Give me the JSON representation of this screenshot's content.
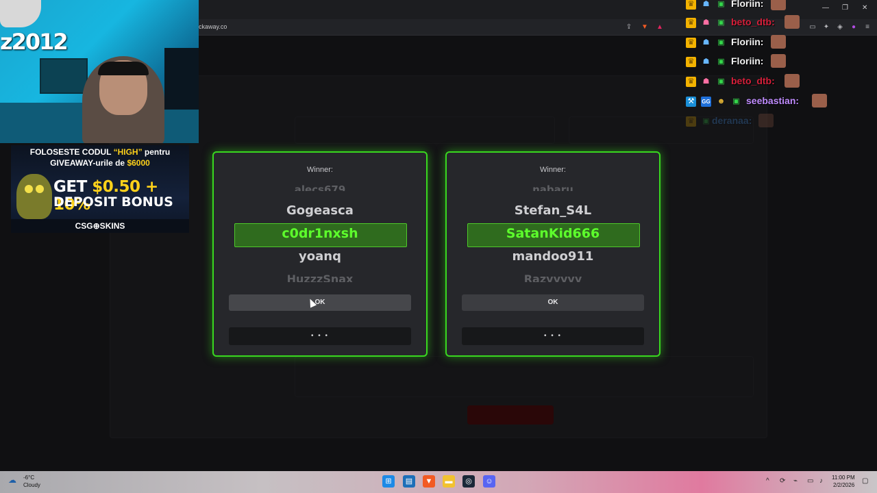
{
  "browser": {
    "url": "ckaway.co",
    "toolbar_icons": [
      "share-icon",
      "brave-shield-icon",
      "rewards-icon"
    ],
    "window_controls": [
      "minimize-icon",
      "maximize-icon",
      "close-icon"
    ]
  },
  "modals": [
    {
      "title": "Winner:",
      "names": [
        "alecs679",
        "Gogeasca",
        "c0dr1nxsh",
        "yoanq",
        "HuzzzSnax"
      ],
      "winner": "c0dr1nxsh",
      "ok_label": "OK",
      "dots_label": "• • •"
    },
    {
      "title": "Winner:",
      "names": [
        "nabaru",
        "Stefan_S4L",
        "SatanKid666",
        "mandoo911",
        "Razyyyyy"
      ],
      "winner": "SatanKid666",
      "ok_label": "OK",
      "dots_label": "• • •"
    }
  ],
  "webcam": {
    "logo_text": "z2012"
  },
  "promo": {
    "line1_a": "FOLOSESTE CODUL ",
    "line1_code": "“HIGH”",
    "line1_b": " pentru",
    "line2_a": "GIVEAWAY-urile de ",
    "line2_amount": "$6000",
    "big1_a": "GET ",
    "big1_b": "$0.50 + 10%",
    "big2": "DEPOSIT BONUS",
    "brand": "CSG⊕SKINS"
  },
  "chat": [
    {
      "name": "Floriin:",
      "color": "#f4f4f4",
      "badges": [
        "crown",
        "ghost",
        "gift"
      ]
    },
    {
      "name": "beto_dtb:",
      "color": "#d61f3a",
      "badges": [
        "crown",
        "pink",
        "gift"
      ]
    },
    {
      "name": "Floriin:",
      "color": "#f4f4f4",
      "badges": [
        "crown",
        "ghost",
        "gift"
      ]
    },
    {
      "name": "Floriin:",
      "color": "#f4f4f4",
      "badges": [
        "crown",
        "ghost",
        "gift"
      ]
    },
    {
      "name": "beto_dtb:",
      "color": "#d61f3a",
      "badges": [
        "crown",
        "pink",
        "gift"
      ]
    },
    {
      "name": "seebastian:",
      "color": "#c08cff",
      "badges": [
        "hammer",
        "gg",
        "face",
        "gift"
      ]
    },
    {
      "name": "deranaa:",
      "color": "#4aa0ff",
      "badges": [
        "crown",
        "gift"
      ]
    }
  ],
  "taskbar": {
    "weather_temp": "-6°C",
    "weather_cond": "Cloudy",
    "clock_time": "11:00 PM",
    "clock_date": "2/2/2026"
  }
}
